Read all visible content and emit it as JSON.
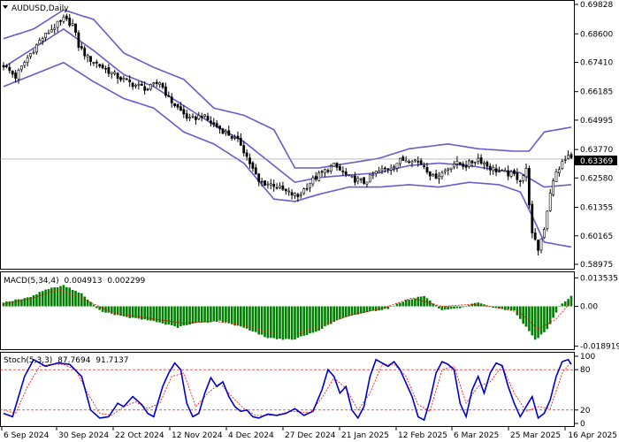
{
  "symbol_title": "AUDUSD,Daily",
  "current_price": "0.63369",
  "colors": {
    "candle": "#000000",
    "bollinger": "#6a5acd",
    "macd_hist": "#008000",
    "macd_signal": "#ff0000",
    "stoch_main": "#0000cd",
    "stoch_signal": "#ff0000",
    "price_tag": "#000000",
    "level_line": "#cc0000"
  },
  "chart_data": [
    {
      "type": "candlestick",
      "title": "AUDUSD,Daily",
      "yticks": [
        "0.69828",
        "0.68600",
        "0.67410",
        "0.66185",
        "0.64995",
        "0.63770",
        "0.62580",
        "0.61355",
        "0.60165",
        "0.58975"
      ],
      "ylim": [
        0.58975,
        0.69828
      ],
      "xticks": [
        "6 Sep 2024",
        "30 Sep 2024",
        "22 Oct 2024",
        "12 Nov 2024",
        "4 Dec 2024",
        "27 Dec 2024",
        "21 Jan 2025",
        "12 Feb 2025",
        "6 Mar 2025",
        "25 Mar 2025",
        "16 Apr 2025"
      ],
      "last_price": 0.63369,
      "close_path": [
        [
          0,
          0.673
        ],
        [
          4,
          0.668
        ],
        [
          8,
          0.676
        ],
        [
          12,
          0.683
        ],
        [
          16,
          0.688
        ],
        [
          20,
          0.692
        ],
        [
          23,
          0.69
        ],
        [
          25,
          0.681
        ],
        [
          28,
          0.676
        ],
        [
          33,
          0.672
        ],
        [
          38,
          0.668
        ],
        [
          43,
          0.665
        ],
        [
          48,
          0.663
        ],
        [
          52,
          0.666
        ],
        [
          55,
          0.659
        ],
        [
          58,
          0.655
        ],
        [
          62,
          0.65
        ],
        [
          66,
          0.652
        ],
        [
          70,
          0.648
        ],
        [
          75,
          0.644
        ],
        [
          79,
          0.64
        ],
        [
          82,
          0.632
        ],
        [
          85,
          0.624
        ],
        [
          90,
          0.623
        ],
        [
          94,
          0.62
        ],
        [
          98,
          0.618
        ],
        [
          102,
          0.624
        ],
        [
          106,
          0.628
        ],
        [
          110,
          0.631
        ],
        [
          115,
          0.626
        ],
        [
          120,
          0.624
        ],
        [
          124,
          0.628
        ],
        [
          128,
          0.63
        ],
        [
          132,
          0.633
        ],
        [
          136,
          0.634
        ],
        [
          140,
          0.631
        ],
        [
          143,
          0.626
        ],
        [
          146,
          0.628
        ],
        [
          150,
          0.632
        ],
        [
          154,
          0.631
        ],
        [
          158,
          0.634
        ],
        [
          162,
          0.63
        ],
        [
          166,
          0.628
        ],
        [
          170,
          0.627
        ],
        [
          172,
          0.625
        ],
        [
          174,
          0.629
        ],
        [
          176,
          0.602
        ],
        [
          178,
          0.596
        ],
        [
          180,
          0.605
        ],
        [
          182,
          0.62
        ],
        [
          184,
          0.628
        ],
        [
          186,
          0.632
        ],
        [
          188,
          0.635
        ],
        [
          189,
          0.6337
        ]
      ],
      "bollinger_upper": [
        [
          0,
          0.684
        ],
        [
          10,
          0.688
        ],
        [
          20,
          0.696
        ],
        [
          30,
          0.692
        ],
        [
          40,
          0.678
        ],
        [
          50,
          0.672
        ],
        [
          60,
          0.667
        ],
        [
          70,
          0.655
        ],
        [
          80,
          0.652
        ],
        [
          90,
          0.646
        ],
        [
          97,
          0.63
        ],
        [
          105,
          0.63
        ],
        [
          115,
          0.632
        ],
        [
          125,
          0.634
        ],
        [
          135,
          0.638
        ],
        [
          148,
          0.64
        ],
        [
          158,
          0.638
        ],
        [
          170,
          0.637
        ],
        [
          175,
          0.637
        ],
        [
          180,
          0.645
        ],
        [
          189,
          0.647
        ]
      ],
      "bollinger_middle": [
        [
          0,
          0.672
        ],
        [
          10,
          0.68
        ],
        [
          20,
          0.688
        ],
        [
          30,
          0.679
        ],
        [
          40,
          0.669
        ],
        [
          50,
          0.664
        ],
        [
          60,
          0.656
        ],
        [
          70,
          0.648
        ],
        [
          80,
          0.641
        ],
        [
          90,
          0.631
        ],
        [
          97,
          0.624
        ],
        [
          105,
          0.626
        ],
        [
          115,
          0.627
        ],
        [
          125,
          0.628
        ],
        [
          135,
          0.631
        ],
        [
          145,
          0.632
        ],
        [
          155,
          0.631
        ],
        [
          165,
          0.629
        ],
        [
          172,
          0.628
        ],
        [
          180,
          0.622
        ],
        [
          189,
          0.623
        ]
      ],
      "bollinger_lower": [
        [
          0,
          0.664
        ],
        [
          10,
          0.669
        ],
        [
          20,
          0.674
        ],
        [
          30,
          0.666
        ],
        [
          40,
          0.659
        ],
        [
          50,
          0.655
        ],
        [
          60,
          0.645
        ],
        [
          70,
          0.64
        ],
        [
          80,
          0.632
        ],
        [
          90,
          0.617
        ],
        [
          97,
          0.616
        ],
        [
          105,
          0.619
        ],
        [
          115,
          0.622
        ],
        [
          125,
          0.622
        ],
        [
          135,
          0.623
        ],
        [
          145,
          0.622
        ],
        [
          155,
          0.624
        ],
        [
          165,
          0.623
        ],
        [
          172,
          0.62
        ],
        [
          176,
          0.61
        ],
        [
          180,
          0.599
        ],
        [
          189,
          0.597
        ]
      ]
    },
    {
      "type": "bar",
      "title": "MACD(5,34,4)",
      "legend": [
        "0.004913",
        "0.002299"
      ],
      "yticks": [
        "0.013535",
        "0.00",
        "-0.018919"
      ],
      "ylim": [
        -0.0195,
        0.0145
      ],
      "hist_path": [
        [
          0,
          0.002
        ],
        [
          8,
          0.004
        ],
        [
          14,
          0.008
        ],
        [
          20,
          0.01
        ],
        [
          26,
          0.006
        ],
        [
          32,
          -0.002
        ],
        [
          40,
          -0.005
        ],
        [
          50,
          -0.007
        ],
        [
          58,
          -0.01
        ],
        [
          64,
          -0.008
        ],
        [
          72,
          -0.007
        ],
        [
          80,
          -0.01
        ],
        [
          88,
          -0.015
        ],
        [
          96,
          -0.016
        ],
        [
          104,
          -0.012
        ],
        [
          112,
          -0.006
        ],
        [
          120,
          -0.003
        ],
        [
          128,
          -0.001
        ],
        [
          134,
          0.003
        ],
        [
          140,
          0.005
        ],
        [
          146,
          -0.002
        ],
        [
          152,
          -0.001
        ],
        [
          158,
          0.002
        ],
        [
          164,
          -0.001
        ],
        [
          170,
          -0.002
        ],
        [
          174,
          -0.01
        ],
        [
          177,
          -0.016
        ],
        [
          181,
          -0.011
        ],
        [
          185,
          0.0
        ],
        [
          189,
          0.0049
        ]
      ],
      "signal_path": [
        [
          0,
          0.001
        ],
        [
          10,
          0.004
        ],
        [
          18,
          0.008
        ],
        [
          26,
          0.004
        ],
        [
          36,
          -0.003
        ],
        [
          50,
          -0.006
        ],
        [
          60,
          -0.008
        ],
        [
          70,
          -0.007
        ],
        [
          80,
          -0.009
        ],
        [
          90,
          -0.013
        ],
        [
          98,
          -0.013
        ],
        [
          106,
          -0.009
        ],
        [
          116,
          -0.004
        ],
        [
          126,
          -0.001
        ],
        [
          136,
          0.004
        ],
        [
          146,
          0.0
        ],
        [
          156,
          0.001
        ],
        [
          166,
          -0.001
        ],
        [
          172,
          -0.003
        ],
        [
          178,
          -0.011
        ],
        [
          184,
          -0.006
        ],
        [
          189,
          0.0023
        ]
      ]
    },
    {
      "type": "line",
      "title": "Stoch(5,3,3)",
      "legend": [
        "87.7694",
        "91.7137"
      ],
      "yticks": [
        "100",
        "80",
        "20",
        "0"
      ],
      "levels": [
        80,
        20
      ],
      "ylim": [
        0,
        100
      ],
      "main_path": [
        [
          0,
          15
        ],
        [
          3,
          10
        ],
        [
          7,
          70
        ],
        [
          10,
          95
        ],
        [
          14,
          85
        ],
        [
          18,
          90
        ],
        [
          22,
          88
        ],
        [
          26,
          70
        ],
        [
          29,
          20
        ],
        [
          32,
          8
        ],
        [
          35,
          10
        ],
        [
          38,
          30
        ],
        [
          40,
          25
        ],
        [
          43,
          40
        ],
        [
          46,
          28
        ],
        [
          48,
          15
        ],
        [
          50,
          10
        ],
        [
          53,
          55
        ],
        [
          55,
          75
        ],
        [
          57,
          90
        ],
        [
          59,
          80
        ],
        [
          61,
          30
        ],
        [
          63,
          10
        ],
        [
          65,
          15
        ],
        [
          67,
          45
        ],
        [
          69,
          68
        ],
        [
          71,
          55
        ],
        [
          73,
          62
        ],
        [
          75,
          40
        ],
        [
          77,
          25
        ],
        [
          79,
          18
        ],
        [
          81,
          20
        ],
        [
          83,
          10
        ],
        [
          85,
          8
        ],
        [
          88,
          14
        ],
        [
          91,
          12
        ],
        [
          94,
          15
        ],
        [
          97,
          22
        ],
        [
          100,
          12
        ],
        [
          103,
          18
        ],
        [
          106,
          50
        ],
        [
          108,
          80
        ],
        [
          110,
          70
        ],
        [
          112,
          45
        ],
        [
          114,
          55
        ],
        [
          116,
          20
        ],
        [
          118,
          8
        ],
        [
          120,
          25
        ],
        [
          122,
          70
        ],
        [
          124,
          95
        ],
        [
          126,
          90
        ],
        [
          128,
          85
        ],
        [
          130,
          92
        ],
        [
          132,
          80
        ],
        [
          134,
          60
        ],
        [
          136,
          40
        ],
        [
          138,
          10
        ],
        [
          140,
          5
        ],
        [
          142,
          35
        ],
        [
          144,
          75
        ],
        [
          146,
          92
        ],
        [
          148,
          88
        ],
        [
          150,
          80
        ],
        [
          152,
          30
        ],
        [
          154,
          10
        ],
        [
          156,
          50
        ],
        [
          158,
          70
        ],
        [
          160,
          45
        ],
        [
          162,
          75
        ],
        [
          164,
          90
        ],
        [
          166,
          86
        ],
        [
          168,
          55
        ],
        [
          170,
          30
        ],
        [
          172,
          10
        ],
        [
          174,
          25
        ],
        [
          176,
          40
        ],
        [
          178,
          8
        ],
        [
          180,
          15
        ],
        [
          182,
          35
        ],
        [
          184,
          70
        ],
        [
          186,
          92
        ],
        [
          188,
          95
        ],
        [
          189,
          88
        ]
      ],
      "signal_path": [
        [
          0,
          20
        ],
        [
          4,
          15
        ],
        [
          8,
          55
        ],
        [
          12,
          85
        ],
        [
          16,
          88
        ],
        [
          20,
          88
        ],
        [
          24,
          80
        ],
        [
          28,
          45
        ],
        [
          32,
          15
        ],
        [
          36,
          12
        ],
        [
          40,
          25
        ],
        [
          44,
          32
        ],
        [
          48,
          22
        ],
        [
          52,
          30
        ],
        [
          56,
          70
        ],
        [
          60,
          75
        ],
        [
          64,
          25
        ],
        [
          68,
          45
        ],
        [
          72,
          60
        ],
        [
          76,
          40
        ],
        [
          80,
          22
        ],
        [
          84,
          12
        ],
        [
          90,
          12
        ],
        [
          96,
          18
        ],
        [
          102,
          16
        ],
        [
          106,
          38
        ],
        [
          110,
          68
        ],
        [
          114,
          52
        ],
        [
          118,
          20
        ],
        [
          122,
          45
        ],
        [
          126,
          88
        ],
        [
          130,
          88
        ],
        [
          134,
          70
        ],
        [
          138,
          28
        ],
        [
          142,
          18
        ],
        [
          146,
          80
        ],
        [
          150,
          85
        ],
        [
          154,
          30
        ],
        [
          158,
          55
        ],
        [
          162,
          62
        ],
        [
          166,
          85
        ],
        [
          170,
          45
        ],
        [
          174,
          18
        ],
        [
          178,
          25
        ],
        [
          182,
          22
        ],
        [
          186,
          75
        ],
        [
          189,
          92
        ]
      ]
    }
  ]
}
